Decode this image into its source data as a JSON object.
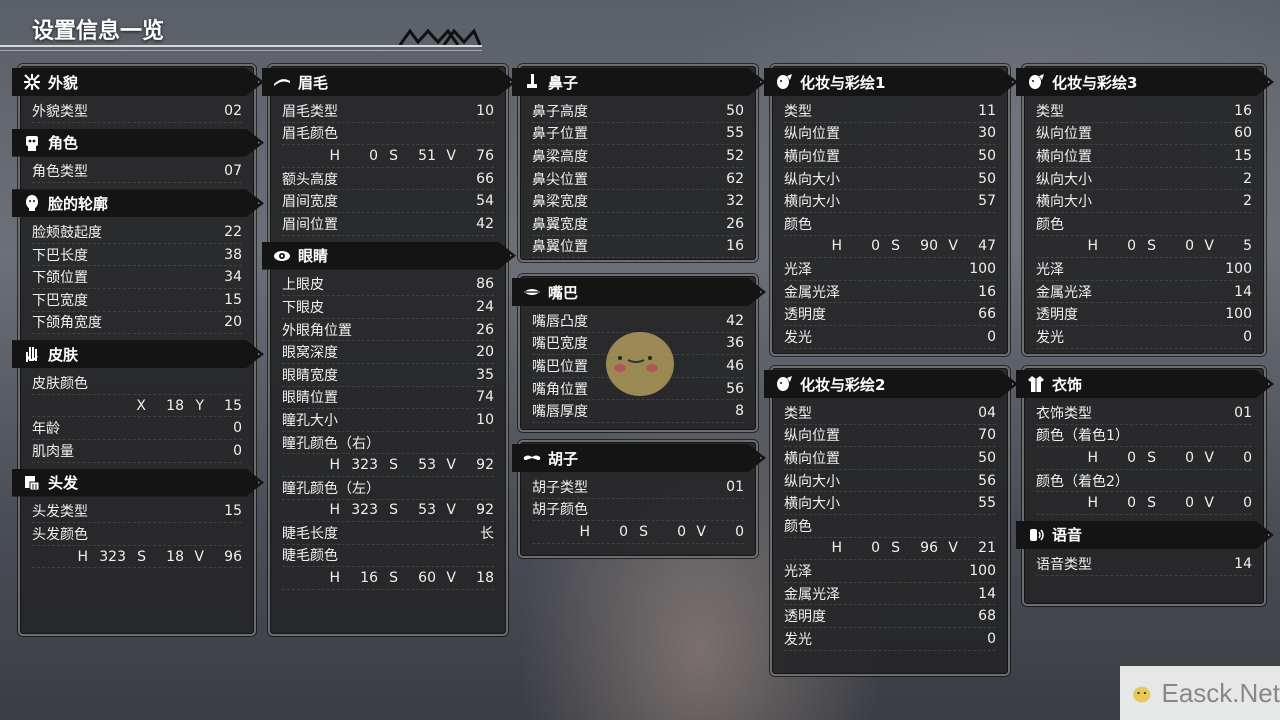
{
  "header": {
    "title": "设置信息一览"
  },
  "watermark": {
    "text": "Easck.Net"
  },
  "columns": [
    [
      {
        "icon": "appearance-icon",
        "label": "外貌",
        "rows": [
          {
            "k": "外貌类型",
            "v": "02"
          }
        ]
      },
      {
        "icon": "character-icon",
        "label": "角色",
        "rows": [
          {
            "k": "角色类型",
            "v": "07"
          }
        ]
      },
      {
        "icon": "face-icon",
        "label": "脸的轮廓",
        "rows": [
          {
            "k": "脸颊鼓起度",
            "v": "22"
          },
          {
            "k": "下巴长度",
            "v": "38"
          },
          {
            "k": "下颌位置",
            "v": "34"
          },
          {
            "k": "下巴宽度",
            "v": "15"
          },
          {
            "k": "下颌角宽度",
            "v": "20"
          }
        ]
      },
      {
        "icon": "hand-icon",
        "label": "皮肤",
        "rows": [
          {
            "k": "皮肤颜色",
            "v": ""
          },
          {
            "sub": [
              [
                "X",
                "18"
              ],
              [
                "Y",
                "15"
              ]
            ]
          },
          {
            "k": "年龄",
            "v": "0"
          },
          {
            "k": "肌肉量",
            "v": "0"
          }
        ]
      },
      {
        "icon": "hair-icon",
        "label": "头发",
        "rows": [
          {
            "k": "头发类型",
            "v": "15"
          },
          {
            "k": "头发颜色",
            "v": ""
          },
          {
            "sub": [
              [
                "H",
                "323"
              ],
              [
                "S",
                "18"
              ],
              [
                "V",
                "96"
              ]
            ]
          }
        ]
      }
    ],
    [
      {
        "icon": "eyebrow-icon",
        "label": "眉毛",
        "rows": [
          {
            "k": "眉毛类型",
            "v": "10"
          },
          {
            "k": "眉毛颜色",
            "v": ""
          },
          {
            "sub": [
              [
                "H",
                "0"
              ],
              [
                "S",
                "51"
              ],
              [
                "V",
                "76"
              ]
            ]
          },
          {
            "k": "额头高度",
            "v": "66"
          },
          {
            "k": "眉间宽度",
            "v": "54"
          },
          {
            "k": "眉间位置",
            "v": "42"
          }
        ]
      },
      {
        "icon": "eye-icon",
        "label": "眼睛",
        "rows": [
          {
            "k": "上眼皮",
            "v": "86"
          },
          {
            "k": "下眼皮",
            "v": "24"
          },
          {
            "k": "外眼角位置",
            "v": "26"
          },
          {
            "k": "眼窝深度",
            "v": "20"
          },
          {
            "k": "眼睛宽度",
            "v": "35"
          },
          {
            "k": "眼睛位置",
            "v": "74"
          },
          {
            "k": "瞳孔大小",
            "v": "10"
          },
          {
            "k": "瞳孔颜色（右）",
            "v": ""
          },
          {
            "sub": [
              [
                "H",
                "323"
              ],
              [
                "S",
                "53"
              ],
              [
                "V",
                "92"
              ]
            ]
          },
          {
            "k": "瞳孔颜色（左）",
            "v": ""
          },
          {
            "sub": [
              [
                "H",
                "323"
              ],
              [
                "S",
                "53"
              ],
              [
                "V",
                "92"
              ]
            ]
          },
          {
            "k": "睫毛长度",
            "v": "长"
          },
          {
            "k": "睫毛颜色",
            "v": ""
          },
          {
            "sub": [
              [
                "H",
                "16"
              ],
              [
                "S",
                "60"
              ],
              [
                "V",
                "18"
              ]
            ]
          }
        ]
      }
    ],
    [
      {
        "icon": "nose-icon",
        "label": "鼻子",
        "rows": [
          {
            "k": "鼻子高度",
            "v": "50"
          },
          {
            "k": "鼻子位置",
            "v": "55"
          },
          {
            "k": "鼻梁高度",
            "v": "52"
          },
          {
            "k": "鼻尖位置",
            "v": "62"
          },
          {
            "k": "鼻梁宽度",
            "v": "32"
          },
          {
            "k": "鼻翼宽度",
            "v": "26"
          },
          {
            "k": "鼻翼位置",
            "v": "16"
          }
        ]
      },
      {
        "icon": "mouth-icon",
        "label": "嘴巴",
        "rows": [
          {
            "k": "嘴唇凸度",
            "v": "42"
          },
          {
            "k": "嘴巴宽度",
            "v": "36"
          },
          {
            "k": "嘴巴位置",
            "v": "46"
          },
          {
            "k": "嘴角位置",
            "v": "56"
          },
          {
            "k": "嘴唇厚度",
            "v": "8"
          }
        ]
      },
      {
        "icon": "mustache-icon",
        "label": "胡子",
        "rows": [
          {
            "k": "胡子类型",
            "v": "01"
          },
          {
            "k": "胡子颜色",
            "v": ""
          },
          {
            "sub": [
              [
                "H",
                "0"
              ],
              [
                "S",
                "0"
              ],
              [
                "V",
                "0"
              ]
            ]
          }
        ]
      }
    ],
    [
      {
        "icon": "makeup-icon",
        "label": "化妆与彩绘1",
        "rows": [
          {
            "k": "类型",
            "v": "11"
          },
          {
            "k": "纵向位置",
            "v": "30"
          },
          {
            "k": "横向位置",
            "v": "50"
          },
          {
            "k": "纵向大小",
            "v": "50"
          },
          {
            "k": "横向大小",
            "v": "57"
          },
          {
            "k": "颜色",
            "v": ""
          },
          {
            "sub": [
              [
                "H",
                "0"
              ],
              [
                "S",
                "90"
              ],
              [
                "V",
                "47"
              ]
            ]
          },
          {
            "k": "光泽",
            "v": "100"
          },
          {
            "k": "金属光泽",
            "v": "16"
          },
          {
            "k": "透明度",
            "v": "66"
          },
          {
            "k": "发光",
            "v": "0"
          }
        ]
      },
      {
        "icon": "makeup-icon",
        "label": "化妆与彩绘2",
        "rows": [
          {
            "k": "类型",
            "v": "04"
          },
          {
            "k": "纵向位置",
            "v": "70"
          },
          {
            "k": "横向位置",
            "v": "50"
          },
          {
            "k": "纵向大小",
            "v": "56"
          },
          {
            "k": "横向大小",
            "v": "55"
          },
          {
            "k": "颜色",
            "v": ""
          },
          {
            "sub": [
              [
                "H",
                "0"
              ],
              [
                "S",
                "96"
              ],
              [
                "V",
                "21"
              ]
            ]
          },
          {
            "k": "光泽",
            "v": "100"
          },
          {
            "k": "金属光泽",
            "v": "14"
          },
          {
            "k": "透明度",
            "v": "68"
          },
          {
            "k": "发光",
            "v": "0"
          }
        ]
      }
    ],
    [
      {
        "icon": "makeup-icon",
        "label": "化妆与彩绘3",
        "rows": [
          {
            "k": "类型",
            "v": "16"
          },
          {
            "k": "纵向位置",
            "v": "60"
          },
          {
            "k": "横向位置",
            "v": "15"
          },
          {
            "k": "纵向大小",
            "v": "2"
          },
          {
            "k": "横向大小",
            "v": "2"
          },
          {
            "k": "颜色",
            "v": ""
          },
          {
            "sub": [
              [
                "H",
                "0"
              ],
              [
                "S",
                "0"
              ],
              [
                "V",
                "5"
              ]
            ]
          },
          {
            "k": "光泽",
            "v": "100"
          },
          {
            "k": "金属光泽",
            "v": "14"
          },
          {
            "k": "透明度",
            "v": "100"
          },
          {
            "k": "发光",
            "v": "0"
          }
        ]
      },
      {
        "icon": "clothing-icon",
        "label": "衣饰",
        "rows": [
          {
            "k": "衣饰类型",
            "v": "01"
          },
          {
            "k": "颜色（着色1）",
            "v": ""
          },
          {
            "sub": [
              [
                "H",
                "0"
              ],
              [
                "S",
                "0"
              ],
              [
                "V",
                "0"
              ]
            ]
          },
          {
            "k": "颜色（着色2）",
            "v": ""
          },
          {
            "sub": [
              [
                "H",
                "0"
              ],
              [
                "S",
                "0"
              ],
              [
                "V",
                "0"
              ]
            ]
          }
        ]
      },
      {
        "icon": "voice-icon",
        "label": "语音",
        "rows": [
          {
            "k": "语音类型",
            "v": "14"
          }
        ]
      }
    ]
  ]
}
